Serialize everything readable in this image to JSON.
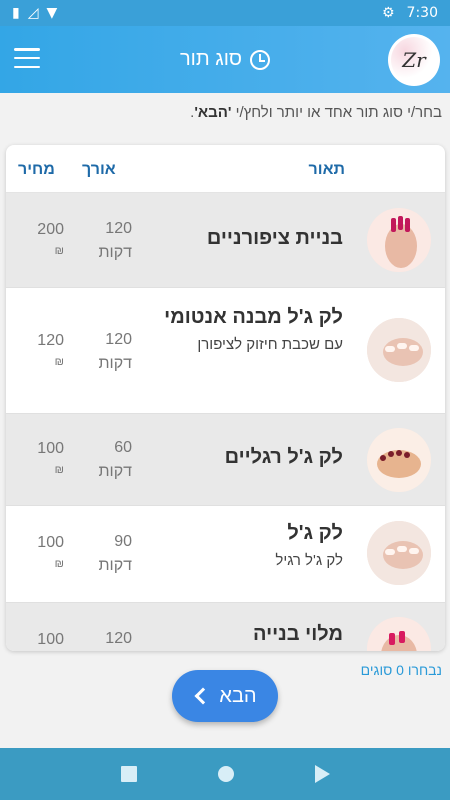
{
  "status_bar": {
    "time": "7:30"
  },
  "app_bar": {
    "title": "סוג תור",
    "logo_text": "Zr"
  },
  "instruction": {
    "text": "בחר/י סוג תור אחד או יותר ולחץ/י ",
    "emphasis": "'הבא'",
    "end": "."
  },
  "table": {
    "headers": {
      "description": "תאור",
      "length": "אורך",
      "price": "מחיר"
    },
    "rows": [
      {
        "name": "בניית ציפורניים",
        "subtitle": "",
        "length": "120",
        "length_unit": "דקות",
        "price": "200",
        "currency": "₪"
      },
      {
        "name": "לק ג'ל מבנה אנטומי",
        "subtitle": "עם שכבת חיזוק לציפורן",
        "length": "120",
        "length_unit": "דקות",
        "price": "120",
        "currency": "₪"
      },
      {
        "name": "לק ג'ל רגליים",
        "subtitle": "",
        "length": "60",
        "length_unit": "דקות",
        "price": "100",
        "currency": "₪"
      },
      {
        "name": "לק ג'ל",
        "subtitle": "לק ג'ל רגיל",
        "length": "90",
        "length_unit": "דקות",
        "price": "100",
        "currency": "₪"
      },
      {
        "name": "מלוי בנייה",
        "subtitle": "",
        "length": "120",
        "length_unit": "",
        "price": "100",
        "currency": ""
      }
    ]
  },
  "selection": {
    "count_text": "נבחרו 0 סוגים"
  },
  "next_button": {
    "label": "הבא"
  },
  "colors": {
    "primary": "#3aa0d8",
    "button": "#3a86e4",
    "header_text": "#1e6aa8",
    "nav": "#3b9bc2"
  }
}
